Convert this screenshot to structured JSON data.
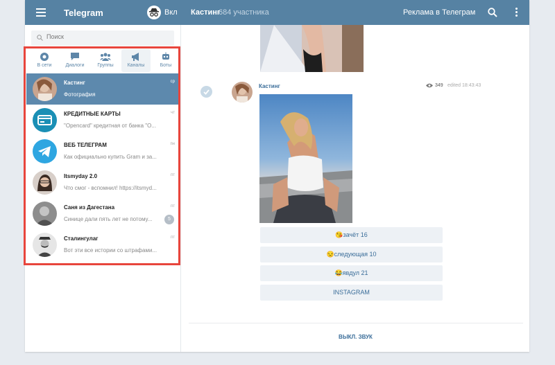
{
  "header": {
    "app_title": "Telegram",
    "incognito_label": "Вкл",
    "chat_title": "Кастинг",
    "chat_subtitle": "684 участника",
    "ad_link": "Реклама в Телеграм"
  },
  "search": {
    "placeholder": "Поиск"
  },
  "tabs": [
    {
      "label": "В сети",
      "icon": "circle-icon"
    },
    {
      "label": "Диалоги",
      "icon": "chat-bubble-icon"
    },
    {
      "label": "Группы",
      "icon": "people-icon"
    },
    {
      "label": "Каналы",
      "icon": "megaphone-icon",
      "active": true
    },
    {
      "label": "Боты",
      "icon": "robot-icon"
    }
  ],
  "dialogs": [
    {
      "name": "Кастинг",
      "preview": "Фотография",
      "date": "ср",
      "active": true
    },
    {
      "name": "КРЕДИТНЫЕ КАРТЫ",
      "preview": "\"Opencard\" кредитная от банка \"О...",
      "date": "чт"
    },
    {
      "name": "ВЕБ ТЕЛЕГРАМ",
      "preview": "Как официально купить Gram и за...",
      "date": "пн"
    },
    {
      "name": "Itsmyday 2.0",
      "preview": "Что смог - вспомнил! https://itsmyd...",
      "date": "пт"
    },
    {
      "name": "Саня из Дагестана",
      "preview": "Синице дали пять лет не потому...",
      "date": "пт",
      "badge": "5"
    },
    {
      "name": "Сталингулаг",
      "preview": "Вот эти все истории со штрафами...",
      "date": "пт"
    }
  ],
  "message": {
    "author": "Кастинг",
    "views": "349",
    "time": "edited 18:43:43"
  },
  "keyboard": [
    {
      "emoji": "😘",
      "text": "зачёт 16"
    },
    {
      "emoji": "😒",
      "text": "следующая 10"
    },
    {
      "emoji": "😂",
      "text": "явдул 21"
    },
    {
      "emoji": "",
      "text": "INSTAGRAM"
    }
  ],
  "footer": {
    "mute_label": "ВЫКЛ. ЗВУК"
  },
  "colors": {
    "header": "#5682a3",
    "accent": "#3a6d99",
    "highlight": "#e8453c",
    "active_item": "#5d89ad"
  }
}
